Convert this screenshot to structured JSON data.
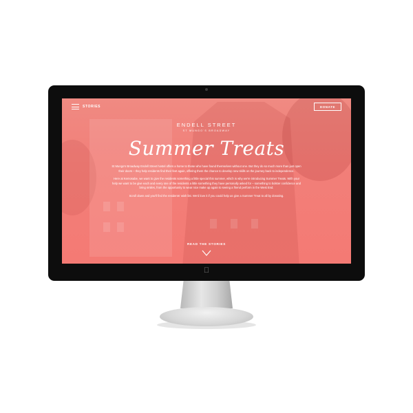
{
  "header": {
    "menu_label": "STORIES",
    "donate_label": "DONATE"
  },
  "brand": {
    "title": "ENDELL STREET",
    "subtitle": "ST MUNGO'S BROADWAY"
  },
  "headline": "Summer Treats",
  "body": {
    "paragraphs": [
      "St Mungo's Broadway Endell Street hostel offers a home to those who have found themselves without one. But they do so much more than just open their doors – they help residents find their feet again, offering them the chance to develop new skills on the journey back to independence.",
      "Here at Kemosabe, we want to give the residents something a little special this summer, which is why we're introducing Summer Treats. With your help we want to be give each and every one of the residents a little something they have personally asked for – something to bolster confidence and bring smiles, from the opportunity to wear nice make up again to seeing a friend perform in the West End.",
      "Scroll down and you'll find the residents' wish list. We'd love it if you could help us give a Summer Treat to all by donating."
    ]
  },
  "cta": {
    "read_label": "READ THE STORIES"
  },
  "icons": {
    "menu": "hamburger-menu-icon",
    "scroll": "chevron-down-icon",
    "logo": "apple-logo-icon"
  },
  "colors": {
    "overlay": "#f27f79",
    "bezel": "#0d0d0d",
    "text": "#ffffff"
  }
}
